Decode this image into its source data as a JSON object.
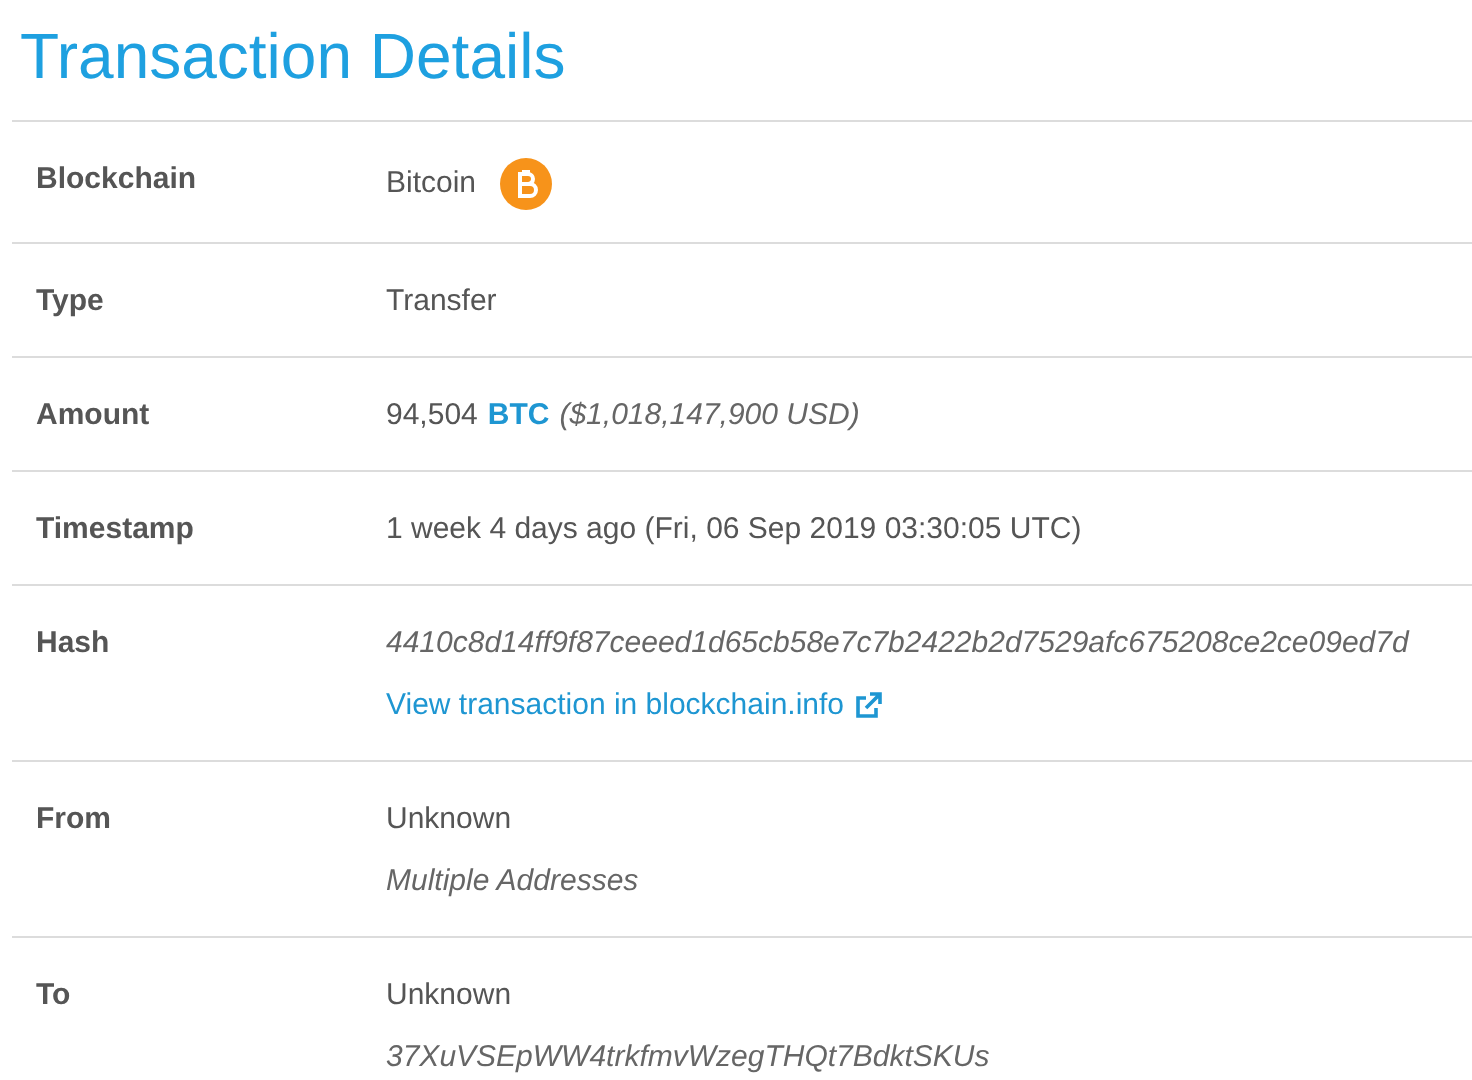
{
  "title": "Transaction Details",
  "rows": [
    {
      "kind": "chain",
      "label": "Blockchain",
      "value": "Bitcoin"
    },
    {
      "kind": "plain",
      "label": "Type",
      "value": "Transfer"
    },
    {
      "kind": "amount",
      "label": "Amount",
      "value": "94,504",
      "unit": "BTC",
      "fiat": "($1,018,147,900 USD)"
    },
    {
      "kind": "plain",
      "label": "Timestamp",
      "value": "1 week 4 days ago (Fri, 06 Sep 2019 03:30:05 UTC)"
    },
    {
      "kind": "hash",
      "label": "Hash",
      "value": "4410c8d14ff9f87ceeed1d65cb58e7c7b2422b2d7529afc675208ce2ce09ed7d",
      "link": "View transaction in blockchain.info"
    },
    {
      "kind": "address",
      "label": "From",
      "value": "Unknown",
      "address": "Multiple Addresses"
    },
    {
      "kind": "address",
      "label": "To",
      "value": "Unknown",
      "address": "37XuVSEpWW4trkfmvWzegTHQt7BdktSKUs"
    }
  ]
}
